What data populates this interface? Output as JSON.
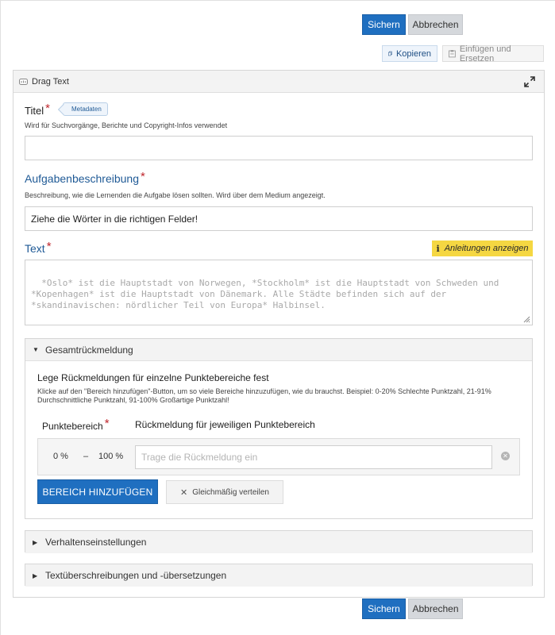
{
  "actions": {
    "save_label": "Sichern",
    "cancel_label": "Abbrechen"
  },
  "clipboard": {
    "copy_label": "Kopieren",
    "paste_label": "Einfügen und Ersetzen",
    "copy_icon": "copy-icon",
    "paste_icon": "clipboard-icon"
  },
  "panel": {
    "title": "Drag Text",
    "lib_icon": "library-icon",
    "expand_icon": "expand-icon"
  },
  "title_field": {
    "label": "Titel",
    "required": "*",
    "meta_tag": "Metadaten",
    "description": "Wird für Suchvorgänge, Berichte und Copyright-Infos verwendet",
    "value": ""
  },
  "task_field": {
    "label": "Aufgabenbeschreibung",
    "required": "*",
    "description": "Beschreibung, wie die Lernenden die Aufgabe lösen sollten. Wird über dem Medium angezeigt.",
    "value": "Ziehe die Wörter in die richtigen Felder!"
  },
  "text_field": {
    "label": "Text",
    "required": "*",
    "hint_button": "Anleitungen anzeigen",
    "placeholder": "*Oslo* ist die Hauptstadt von Norwegen, *Stockholm* ist die Hauptstadt von Schweden und *Kopenhagen* ist die Hauptstadt von Dänemark. Alle Städte befinden sich auf der *skandinavischen: nördlicher Teil von Europa* Halbinsel."
  },
  "overall_feedback": {
    "title": "Gesamtrückmeldung",
    "heading": "Lege Rückmeldungen für einzelne Punktebereiche fest",
    "description": "Klicke auf den \"Bereich hinzufügen\"-Button, um so viele Bereiche hinzuzufügen, wie du brauchst. Beispiel: 0-20% Schlechte Punktzahl, 21-91% Durchschnittliche Punktzahl, 91-100% Großartige Punktzahl!",
    "col_range": "Punktebereich",
    "col_range_required": "*",
    "col_feedback": "Rückmeldung für jeweiligen Punktebereich",
    "range_from": "0 %",
    "range_sep": "–",
    "range_to": "100 %",
    "feedback_placeholder": "Trage die Rückmeldung ein",
    "add_range_label": "BEREICH HINZUFÜGEN",
    "distribute_label": "Gleichmäßig verteilen"
  },
  "sections": {
    "behaviour": "Verhaltenseinstellungen",
    "translations": "Textüberschreibungen und -übersetzungen"
  }
}
